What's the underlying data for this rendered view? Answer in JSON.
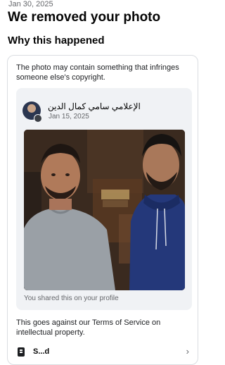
{
  "header": {
    "date": "Jan 30, 2025",
    "title": "We removed your photo",
    "subtitle": "Why this happened"
  },
  "card": {
    "reason": "The photo may contain something that infringes someone else's copyright.",
    "post": {
      "author": "الإعلامي سامي كمال الدين",
      "date": "Jan 15, 2025",
      "shared_note": "You shared this on your profile"
    },
    "policy": "This goes against our Terms of Service on intellectual property.",
    "bottom_label": "S...d"
  },
  "icons": {
    "avatar": "profile-avatar",
    "badge": "avatar-badge-icon",
    "doc": "document-icon",
    "chevron": "chevron-right-icon"
  },
  "colors": {
    "secondary_text": "#65676b",
    "post_background": "#f0f2f5",
    "card_border": "#dadde1"
  }
}
